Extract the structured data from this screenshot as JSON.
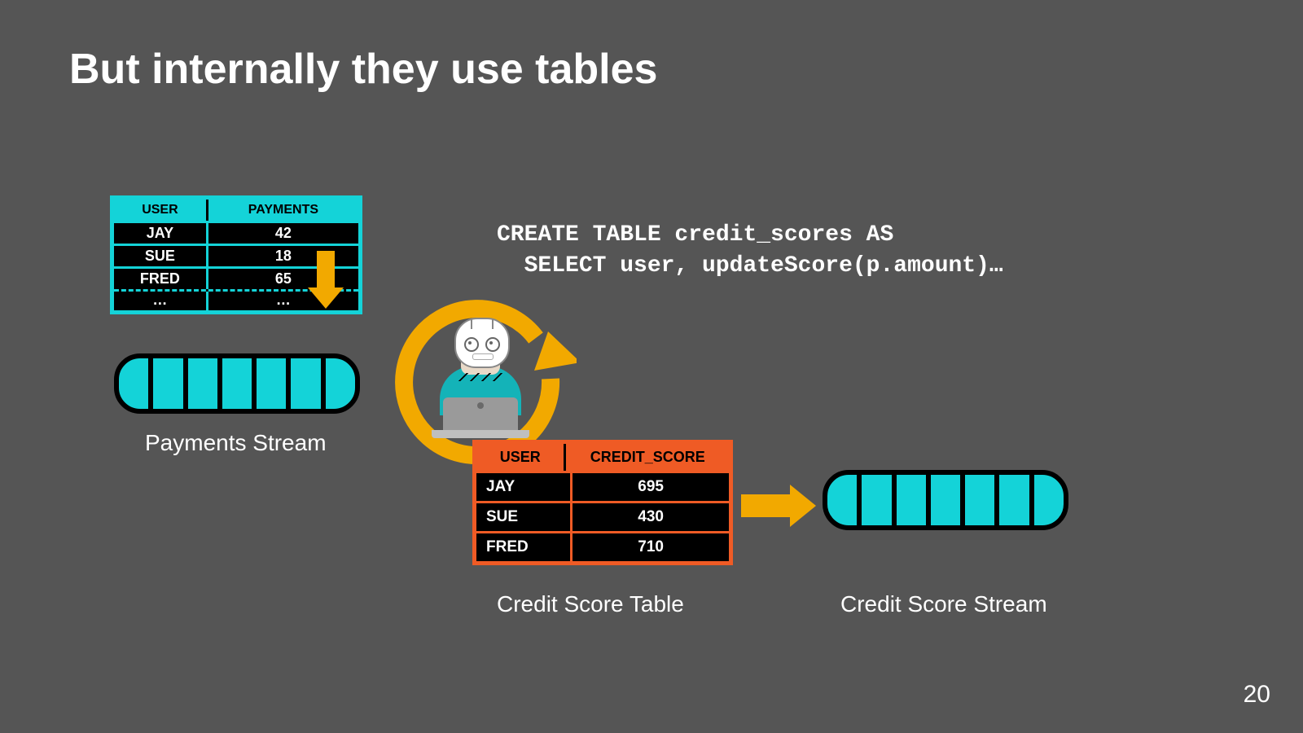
{
  "title": "But internally they use tables",
  "code_line1": "CREATE TABLE credit_scores AS",
  "code_line2": "  SELECT user, updateScore(p.amount)…",
  "payments_table": {
    "headers": {
      "user": "USER",
      "payments": "PAYMENTS"
    },
    "rows": [
      {
        "user": "JAY",
        "payments": "42"
      },
      {
        "user": "SUE",
        "payments": "18"
      },
      {
        "user": "FRED",
        "payments": "65"
      }
    ],
    "ellipsis": "…"
  },
  "credit_table": {
    "headers": {
      "user": "USER",
      "score": "CREDIT_SCORE"
    },
    "rows": [
      {
        "user": "JAY",
        "score": "695"
      },
      {
        "user": "SUE",
        "score": "430"
      },
      {
        "user": "FRED",
        "score": "710"
      }
    ]
  },
  "labels": {
    "payments_stream": "Payments Stream",
    "credit_table": "Credit Score Table",
    "credit_stream": "Credit Score Stream"
  },
  "page_number": "20",
  "colors": {
    "accent_cyan": "#14d3d8",
    "accent_orange": "#ef5b25",
    "arrow": "#f2a900"
  }
}
